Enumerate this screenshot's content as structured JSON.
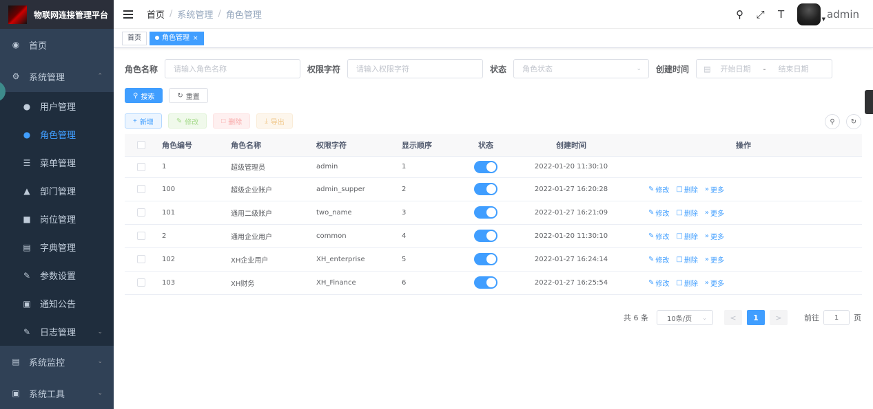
{
  "app": {
    "title": "物联网连接管理平台"
  },
  "sidebar": {
    "items": [
      {
        "label": "首页",
        "icon": "dashboard-icon"
      },
      {
        "label": "系统管理",
        "icon": "gear-icon"
      },
      {
        "label": "系统监控",
        "icon": "monitor-icon"
      },
      {
        "label": "系统工具",
        "icon": "toolbox-icon"
      }
    ],
    "sub": [
      {
        "label": "用户管理",
        "icon": "user-icon"
      },
      {
        "label": "角色管理",
        "icon": "peoples-icon"
      },
      {
        "label": "菜单管理",
        "icon": "tree-table-icon"
      },
      {
        "label": "部门管理",
        "icon": "tree-icon"
      },
      {
        "label": "岗位管理",
        "icon": "post-icon"
      },
      {
        "label": "字典管理",
        "icon": "dict-icon"
      },
      {
        "label": "参数设置",
        "icon": "edit-icon"
      },
      {
        "label": "通知公告",
        "icon": "message-icon"
      },
      {
        "label": "日志管理",
        "icon": "log-icon"
      }
    ]
  },
  "navbar": {
    "breadcrumb": [
      "首页",
      "系统管理",
      "角色管理"
    ],
    "separator": "/",
    "user": "admin"
  },
  "tags": [
    {
      "label": "首页"
    },
    {
      "label": "角色管理",
      "close": "×"
    }
  ],
  "query": {
    "role_name": {
      "label": "角色名称",
      "placeholder": "请输入角色名称"
    },
    "role_key": {
      "label": "权限字符",
      "placeholder": "请输入权限字符"
    },
    "status": {
      "label": "状态",
      "placeholder": "角色状态"
    },
    "create_time": {
      "label": "创建时间",
      "start": "开始日期",
      "sep": "-",
      "end": "结束日期"
    },
    "search": "搜索",
    "reset": "重置"
  },
  "toolbar": {
    "add": "新增",
    "edit": "修改",
    "delete": "删除",
    "export": "导出"
  },
  "table": {
    "columns": [
      "角色编号",
      "角色名称",
      "权限字符",
      "显示顺序",
      "状态",
      "创建时间",
      "操作"
    ],
    "rows": [
      {
        "id": "1",
        "name": "超级管理员",
        "key": "admin",
        "sort": "1",
        "status_on": true,
        "time": "2022-01-20 11:30:10",
        "ops": false
      },
      {
        "id": "100",
        "name": "超级企业账户",
        "key": "admin_supper",
        "sort": "2",
        "status_on": true,
        "time": "2022-01-27 16:20:28",
        "ops": true
      },
      {
        "id": "101",
        "name": "通用二级账户",
        "key": "two_name",
        "sort": "3",
        "status_on": true,
        "time": "2022-01-27 16:21:09",
        "ops": true
      },
      {
        "id": "2",
        "name": "通用企业用户",
        "key": "common",
        "sort": "4",
        "status_on": true,
        "time": "2022-01-20 11:30:10",
        "ops": true
      },
      {
        "id": "102",
        "name": "XH企业用户",
        "key": "XH_enterprise",
        "sort": "5",
        "status_on": true,
        "time": "2022-01-27 16:24:14",
        "ops": true
      },
      {
        "id": "103",
        "name": "XH财务",
        "key": "XH_Finance",
        "sort": "6",
        "status_on": true,
        "time": "2022-01-27 16:25:54",
        "ops": true
      }
    ],
    "op_labels": {
      "edit": "修改",
      "delete": "删除",
      "more": "更多"
    }
  },
  "pagination": {
    "total": "共 6 条",
    "page_size": "10条/页",
    "prev": "<",
    "current": "1",
    "next": ">",
    "goto_label": "前往",
    "goto_value": "1",
    "goto_suffix": "页"
  },
  "colors": {
    "primary": "#409eff",
    "sidebar": "#304156",
    "submenu": "#1f2d3d"
  }
}
